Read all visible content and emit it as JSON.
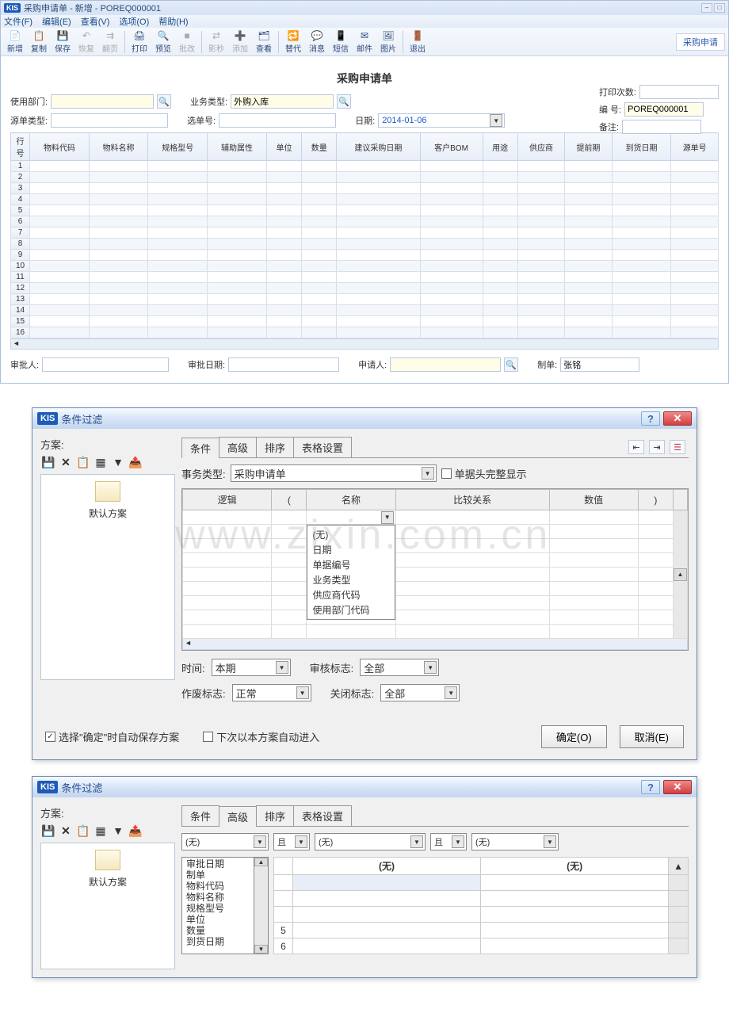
{
  "window": {
    "title": "采购申请单 - 新增 - POREQ000001",
    "right_tab": "采购申请"
  },
  "menu": [
    "文件(F)",
    "编辑(E)",
    "查看(V)",
    "选项(O)",
    "帮助(H)"
  ],
  "toolbar": [
    {
      "label": "新增",
      "icon": "📄",
      "enabled": true
    },
    {
      "label": "复制",
      "icon": "📋",
      "enabled": true
    },
    {
      "label": "保存",
      "icon": "💾",
      "enabled": true
    },
    {
      "label": "恢复",
      "icon": "↶",
      "enabled": false
    },
    {
      "label": "翻页",
      "icon": "⇉",
      "enabled": false
    },
    {
      "label": "打印",
      "icon": "🖨",
      "enabled": true
    },
    {
      "label": "预览",
      "icon": "🔍",
      "enabled": true
    },
    {
      "label": "批改",
      "icon": "■",
      "enabled": false
    },
    {
      "label": "影秒",
      "icon": "⇄",
      "enabled": false
    },
    {
      "label": "添加",
      "icon": "➕",
      "enabled": false
    },
    {
      "label": "查看",
      "icon": "🗂",
      "enabled": true
    },
    {
      "label": "替代",
      "icon": "🔁",
      "enabled": true
    },
    {
      "label": "消息",
      "icon": "💬",
      "enabled": true
    },
    {
      "label": "短信",
      "icon": "📱",
      "enabled": true
    },
    {
      "label": "邮件",
      "icon": "✉",
      "enabled": true
    },
    {
      "label": "图片",
      "icon": "🖼",
      "enabled": true
    },
    {
      "label": "退出",
      "icon": "🚪",
      "enabled": true
    }
  ],
  "form": {
    "title": "采购申请单",
    "dept_label": "使用部门:",
    "dept_value": "",
    "biz_type_label": "业务类型:",
    "biz_type_value": "外购入库",
    "print_count_label": "打印次数:",
    "print_count_value": "",
    "src_type_label": "源单类型:",
    "src_value": "",
    "select_no_label": "选单号:",
    "select_no_value": "",
    "date_label": "日期:",
    "date_value": "2014-01-06",
    "serial_label": "编    号:",
    "serial_value": "POREQ000001",
    "remark_label": "备注:",
    "remark_value": "",
    "approver_label": "审批人:",
    "approver_value": "",
    "approve_date_label": "审批日期:",
    "approve_date_value": "",
    "applicant_label": "申请人:",
    "applicant_value": "",
    "maker_label": "制单:",
    "maker_value": "张铭"
  },
  "grid": {
    "cols": [
      "行号",
      "物料代码",
      "物料名称",
      "规格型号",
      "辅助属性",
      "单位",
      "数量",
      "建议采购日期",
      "客户BOM",
      "用途",
      "供应商",
      "提前期",
      "到货日期",
      "源单号"
    ],
    "rows": 16
  },
  "dialog1": {
    "title": "条件过滤",
    "scheme_label": "方案:",
    "scheme_name": "默认方案",
    "tabs": [
      "条件",
      "高级",
      "排序",
      "表格设置"
    ],
    "biz_label": "事务类型:",
    "biz_value": "采购申请单",
    "header_full": "单据头完整显示",
    "cond_cols": [
      "逻辑",
      "(",
      "名称",
      "比较关系",
      "数值",
      ")"
    ],
    "name_options": [
      "(无)",
      "日期",
      "单据编号",
      "业务类型",
      "供应商代码",
      "使用部门代码"
    ],
    "time_label": "时间:",
    "time_value": "本期",
    "audit_label": "审核标志:",
    "audit_value": "全部",
    "void_label": "作废标志:",
    "void_value": "正常",
    "close_label": "关闭标志:",
    "close_value": "全部",
    "auto_save": "选择\"确定\"时自动保存方案",
    "auto_enter": "下次以本方案自动进入",
    "ok": "确定(O)",
    "cancel": "取消(E)"
  },
  "dialog2": {
    "title": "条件过滤",
    "scheme_label": "方案:",
    "scheme_name": "默认方案",
    "tabs": [
      "条件",
      "高级",
      "排序",
      "表格设置"
    ],
    "sort_none": "(无)",
    "sort_and": "且",
    "sort_options": [
      "审批日期",
      "制单",
      "物料代码",
      "物料名称",
      "规格型号",
      "单位",
      "数量",
      "到货日期"
    ],
    "grid_head": [
      "(无)",
      "(无)"
    ],
    "rownums": [
      "5",
      "6"
    ]
  },
  "watermark": "www.zixin.com.cn"
}
